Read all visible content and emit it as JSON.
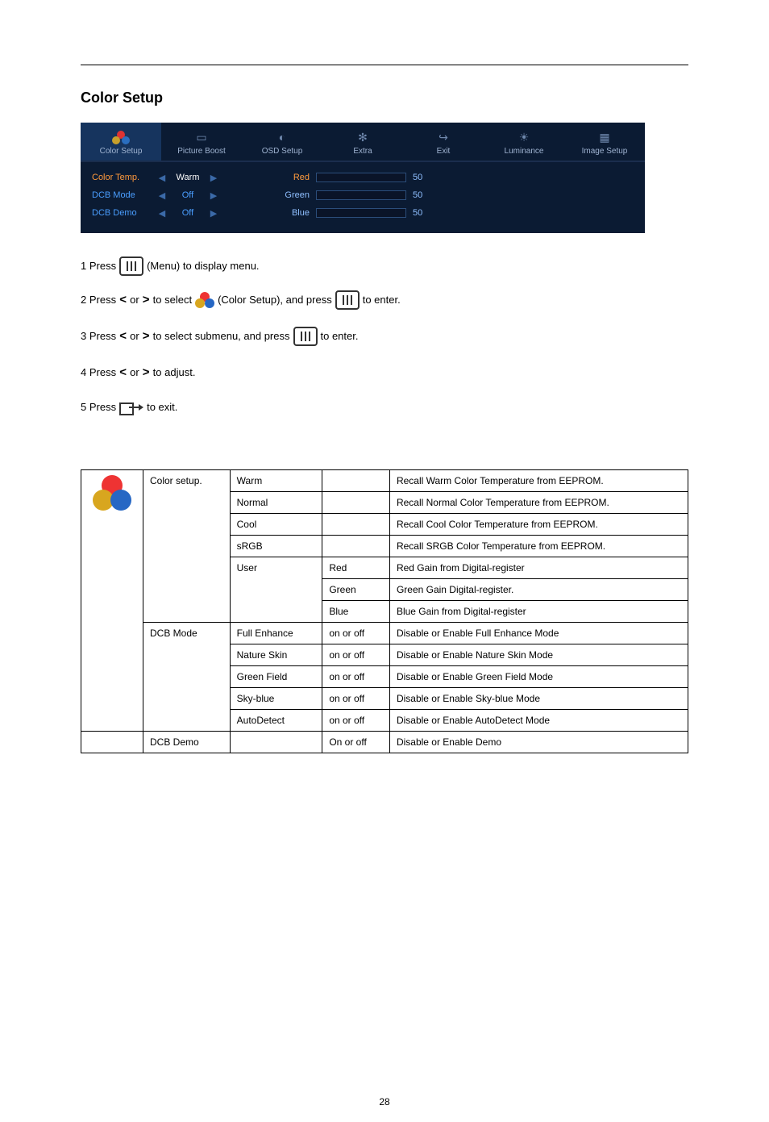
{
  "page": {
    "title": "Color Setup",
    "number": "28"
  },
  "osd": {
    "tabs": {
      "color_setup": "Color Setup",
      "picture_boost": "Picture Boost",
      "osd_setup": "OSD Setup",
      "extra": "Extra",
      "exit": "Exit",
      "luminance": "Luminance",
      "image_setup": "Image Setup"
    },
    "rows": {
      "color_temp": {
        "label": "Color Temp.",
        "value": "Warm"
      },
      "dcb_mode": {
        "label": "DCB Mode",
        "value": "Off"
      },
      "dcb_demo": {
        "label": "DCB Demo",
        "value": "Off"
      }
    },
    "sliders": {
      "red": {
        "label": "Red",
        "value": "50"
      },
      "green": {
        "label": "Green",
        "value": "50"
      },
      "blue": {
        "label": "Blue",
        "value": "50"
      }
    }
  },
  "steps": {
    "s1a": "1 Press",
    "s1b": "(Menu) to display menu.",
    "s2a": "2 Press",
    "s2b": "or",
    "s2c": "to select",
    "s2d": "(Color Setup), and press",
    "s2e": "to enter.",
    "s3a": "3 Press",
    "s3b": "or",
    "s3c": "to select submenu, and press",
    "s3d": "to enter.",
    "s4a": "4 Press",
    "s4b": "or",
    "s4c": "to adjust.",
    "s5a": "5 Press",
    "s5b": "to exit."
  },
  "table": {
    "groups": {
      "color_setup": "Color setup.",
      "dcb_mode": "DCB Mode",
      "dcb_demo": "DCB Demo"
    },
    "rows": [
      {
        "name": "Warm",
        "range": "",
        "desc": "Recall Warm Color Temperature from EEPROM."
      },
      {
        "name": "Normal",
        "range": "",
        "desc": "Recall Normal Color Temperature from EEPROM."
      },
      {
        "name": "Cool",
        "range": "",
        "desc": "Recall Cool Color Temperature from EEPROM."
      },
      {
        "name": "sRGB",
        "range": "",
        "desc": "Recall SRGB Color Temperature from EEPROM."
      },
      {
        "name": "User",
        "range_red": "Red",
        "desc_red": "Red Gain from Digital-register",
        "range_green": "Green",
        "desc_green": "Green Gain Digital-register.",
        "range_blue": "Blue",
        "desc_blue": "Blue Gain from Digital-register"
      },
      {
        "name": "Full Enhance",
        "range": "on or off",
        "desc": "Disable or Enable Full Enhance Mode"
      },
      {
        "name": "Nature Skin",
        "range": "on or off",
        "desc": "Disable or Enable Nature Skin Mode"
      },
      {
        "name": "Green Field",
        "range": "on or off",
        "desc": "Disable or Enable Green Field Mode"
      },
      {
        "name": "Sky-blue",
        "range": "on or off",
        "desc": "Disable or Enable Sky-blue Mode"
      },
      {
        "name": "AutoDetect",
        "range": "on or off",
        "desc": "Disable or Enable AutoDetect Mode"
      },
      {
        "name": "",
        "range": "On or off",
        "desc": "Disable or Enable Demo"
      }
    ]
  }
}
